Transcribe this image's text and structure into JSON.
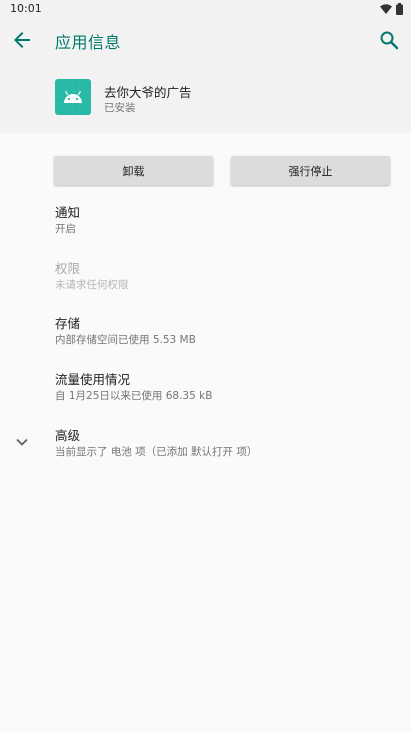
{
  "status_bar": {
    "time": "10:01",
    "wifi_icon": "wifi-icon",
    "battery_icon": "battery-icon"
  },
  "app_bar": {
    "title": "应用信息",
    "back_icon": "arrow-back-icon",
    "search_icon": "search-icon"
  },
  "app": {
    "name": "去你大爷的广告",
    "status": "已安装",
    "icon": "android-robot-icon",
    "icon_color": "#28b8a5"
  },
  "buttons": {
    "uninstall": "卸载",
    "force_stop": "强行停止"
  },
  "settings": [
    {
      "title": "通知",
      "summary": "开启"
    },
    {
      "title": "权限",
      "summary": "未请求任何权限"
    },
    {
      "title": "存储",
      "summary": "内部存储空间已使用 5.53 MB"
    },
    {
      "title": "流量使用情况",
      "summary": "自 1月25日以来已使用 68.35 kB"
    },
    {
      "title": "高级",
      "summary": "当前显示了 电池 项（已添加 默认打开 项）"
    }
  ],
  "colors": {
    "accent": "#00796b",
    "background": "#fafafa",
    "header_bg": "#f2f2f2"
  }
}
